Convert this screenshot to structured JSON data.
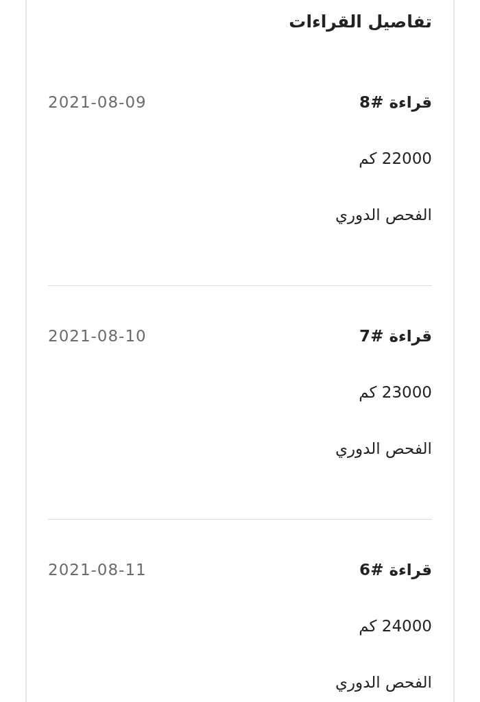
{
  "title": "تفاصيل القراءات",
  "readings": [
    {
      "name": "قراءة #8",
      "date": "2021-08-09",
      "distance": "22000 كم",
      "type": "الفحص الدوري"
    },
    {
      "name": "قراءة #7",
      "date": "2021-08-10",
      "distance": "23000 كم",
      "type": "الفحص الدوري"
    },
    {
      "name": "قراءة #6",
      "date": "2021-08-11",
      "distance": "24000 كم",
      "type": "الفحص الدوري"
    }
  ]
}
